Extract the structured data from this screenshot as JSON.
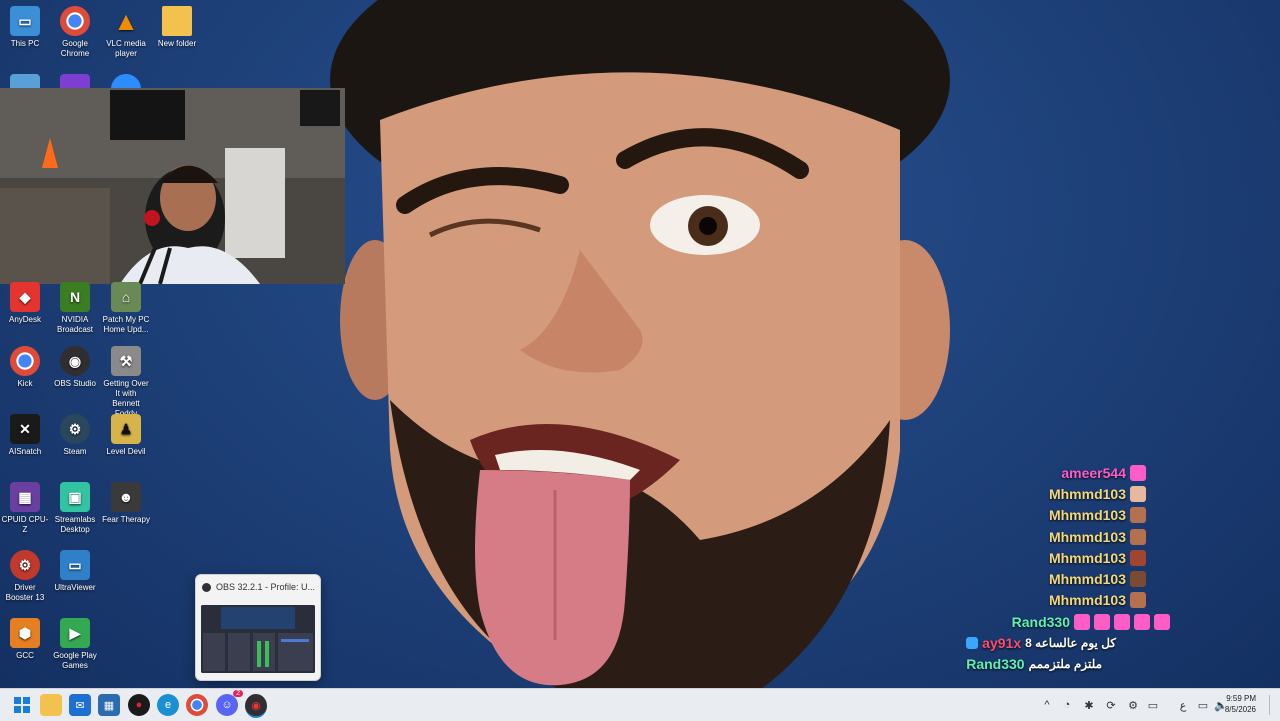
{
  "desktop": {
    "icons": [
      {
        "label": "This PC",
        "icon": "monitor-icon",
        "color": "#3b8fd6"
      },
      {
        "label": "Google Chrome",
        "icon": "chrome-icon",
        "color": "#de4b39"
      },
      {
        "label": "VLC media player",
        "icon": "vlc-icon",
        "color": "#f28b00"
      },
      {
        "label": "New folder",
        "icon": "folder-icon",
        "color": "#f2c14e"
      },
      {
        "label": "AnyDesk",
        "icon": "anydesk-icon",
        "color": "#e3342f"
      },
      {
        "label": "NVIDIA Broadcast",
        "icon": "nvidia-icon",
        "color": "#3a7d22"
      },
      {
        "label": "Patch My PC Home Upd...",
        "icon": "home-update-icon",
        "color": "#6a8a55"
      },
      {
        "label": "Kick",
        "icon": "kick-chrome-icon",
        "color": "#d9d9d9"
      },
      {
        "label": "OBS Studio",
        "icon": "obs-icon",
        "color": "#302e31"
      },
      {
        "label": "Getting Over It with Bennett Foddy",
        "icon": "hammer-icon",
        "color": "#8a8a8a"
      },
      {
        "label": "AISnatch",
        "icon": "aisnatch-icon",
        "color": "#1a1a1a"
      },
      {
        "label": "Steam",
        "icon": "steam-icon",
        "color": "#2a475e"
      },
      {
        "label": "Level Devil",
        "icon": "level-devil-icon",
        "color": "#d6b44a"
      },
      {
        "label": "CPUID CPU-Z",
        "icon": "cpuz-icon",
        "color": "#6a3fa0"
      },
      {
        "label": "Streamlabs Desktop",
        "icon": "streamlabs-icon",
        "color": "#31c3a2"
      },
      {
        "label": "Fear Therapy",
        "icon": "fear-therapy-icon",
        "color": "#3a3a3a"
      },
      {
        "label": "Driver Booster 13",
        "icon": "driver-booster-icon",
        "color": "#c0392b"
      },
      {
        "label": "UltraViewer",
        "icon": "ultraviewer-icon",
        "color": "#2f80c8"
      },
      {
        "label": "GCC",
        "icon": "gcc-icon",
        "color": "#e67e22"
      },
      {
        "label": "Google Play Games",
        "icon": "play-games-icon",
        "color": "#34a853"
      }
    ]
  },
  "chat": {
    "messages": [
      {
        "user": "ameer544",
        "color": "#ff5cc8",
        "text": "",
        "badge": "#ff5cc8"
      },
      {
        "user": "Mhmmd103",
        "color": "#f3d77a",
        "text": "",
        "badge": "#e8b7a0"
      },
      {
        "user": "Mhmmd103",
        "color": "#f3d77a",
        "text": "",
        "badge": "#b5704f"
      },
      {
        "user": "Mhmmd103",
        "color": "#f3d77a",
        "text": "",
        "badge": "#b5704f"
      },
      {
        "user": "Mhmmd103",
        "color": "#f3d77a",
        "text": "",
        "badge": "#a0452f"
      },
      {
        "user": "Mhmmd103",
        "color": "#f3d77a",
        "text": "",
        "badge": "#7a4a32"
      },
      {
        "user": "Mhmmd103",
        "color": "#f3d77a",
        "text": "",
        "badge": "#b5704f"
      },
      {
        "user": "Rand330",
        "color": "#5ff2b0",
        "text": "",
        "badge": "#ff5cc8"
      },
      {
        "user": "ay91x",
        "color": "#ff4b6e",
        "text": "كل يوم عالساعه 8",
        "badge": "#3aa7ff"
      },
      {
        "user": "Rand330",
        "color": "#5ff2b0",
        "text": "ملتزم ملتزممم",
        "badge": ""
      }
    ]
  },
  "obs_preview": {
    "title": "OBS 32.2.1 - Profile: U..."
  },
  "taskbar": {
    "clock_time": "9:59 PM",
    "clock_date": "8/5/2026",
    "lang": "ع",
    "discord_badge": "2"
  }
}
